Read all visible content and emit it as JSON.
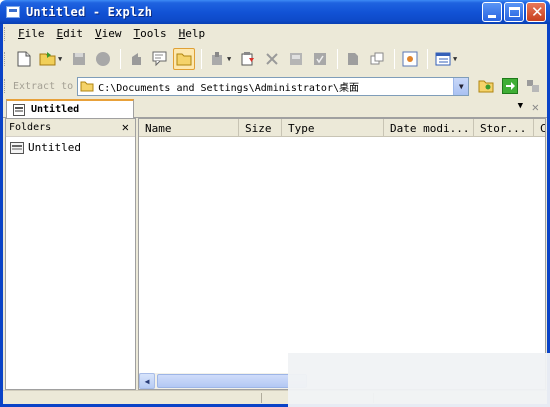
{
  "window": {
    "title": "Untitled - Explzh"
  },
  "menu": [
    {
      "label": "File",
      "accel": "F",
      "rest": "ile"
    },
    {
      "label": "Edit",
      "accel": "E",
      "rest": "dit"
    },
    {
      "label": "View",
      "accel": "V",
      "rest": "iew"
    },
    {
      "label": "Tools",
      "accel": "T",
      "rest": "ools"
    },
    {
      "label": "Help",
      "accel": "H",
      "rest": "elp"
    }
  ],
  "address": {
    "label": "Extract to",
    "path": "C:\\Documents and Settings\\Administrator\\桌面"
  },
  "tab": {
    "label": "Untitled"
  },
  "folders": {
    "title": "Folders",
    "items": [
      {
        "label": "Untitled"
      }
    ]
  },
  "list": {
    "columns": [
      "Name",
      "Size",
      "Type",
      "Date modi...",
      "Stor...",
      "C"
    ]
  },
  "colors": {
    "titlebar": "#1253d6",
    "face": "#ece9d8",
    "tab_accent": "#e8a13a"
  }
}
